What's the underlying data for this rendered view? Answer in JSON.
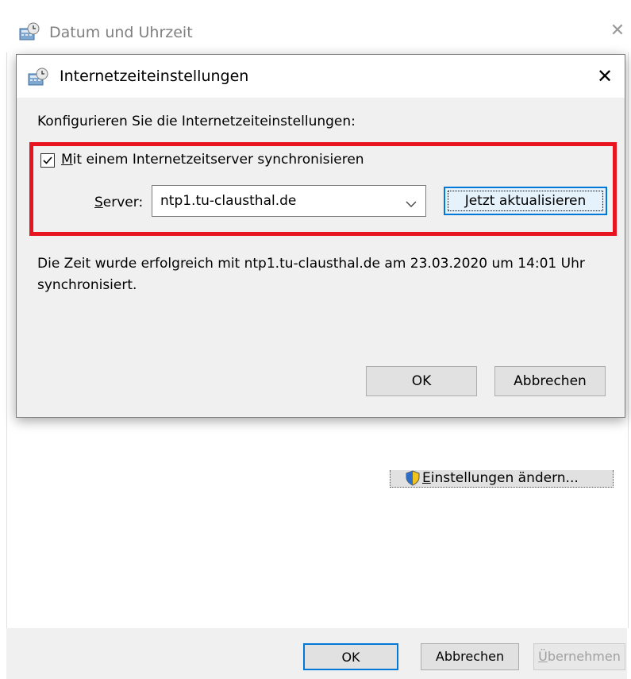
{
  "outer_window": {
    "title": "Datum und Uhrzeit",
    "icon": "clock-settings-icon",
    "close_glyph": "✕",
    "settings_button": {
      "label_accel": "E",
      "label_rest": "instellungen ändern...",
      "icon": "uac-shield-icon"
    },
    "footer": {
      "ok_label": "OK",
      "cancel_label": "Abbrechen",
      "apply_label_accel": "Ü",
      "apply_label_rest": "bernehmen"
    }
  },
  "dialog": {
    "title": "Internetzeiteinstellungen",
    "icon": "clock-settings-icon",
    "close_glyph": "✕",
    "instruction": "Konfigurieren Sie die Internetzeiteinstellungen:",
    "sync": {
      "checked": true,
      "label_accel": "M",
      "label_rest": "it einem Internetzeitserver synchronisieren"
    },
    "server": {
      "label_accel": "S",
      "label_rest": "erver:",
      "value": "ntp1.tu-clausthal.de"
    },
    "update_button": {
      "label_accel": "J",
      "label_rest": "etzt aktualisieren"
    },
    "status": "Die Zeit wurde erfolgreich mit ntp1.tu-clausthal.de am 23.03.2020 um 14:01 Uhr synchronisiert.",
    "ok_label": "OK",
    "cancel_label": "Abbrechen"
  },
  "colors": {
    "highlight_border": "#e8141f",
    "focus_blue": "#0078d7",
    "dialog_body": "#f0f0f0"
  }
}
